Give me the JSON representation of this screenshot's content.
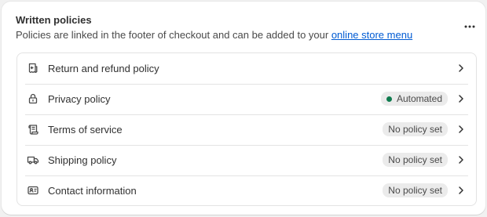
{
  "header": {
    "title": "Written policies",
    "subtitle": "Policies are linked in the footer of checkout and can be added to your ",
    "link_label": "online store menu"
  },
  "rows": [
    {
      "label": "Return and refund policy",
      "badge": null,
      "icon": "receipt-refund-icon"
    },
    {
      "label": "Privacy policy",
      "badge": "Automated",
      "badge_status": "success",
      "icon": "lock-icon"
    },
    {
      "label": "Terms of service",
      "badge": "No policy set",
      "icon": "scroll-icon"
    },
    {
      "label": "Shipping policy",
      "badge": "No policy set",
      "icon": "truck-icon"
    },
    {
      "label": "Contact information",
      "badge": "No policy set",
      "icon": "contact-card-icon"
    }
  ],
  "colors": {
    "link": "#005bd3",
    "success_dot": "#0f7b4e",
    "badge_bg": "#ebebeb"
  }
}
